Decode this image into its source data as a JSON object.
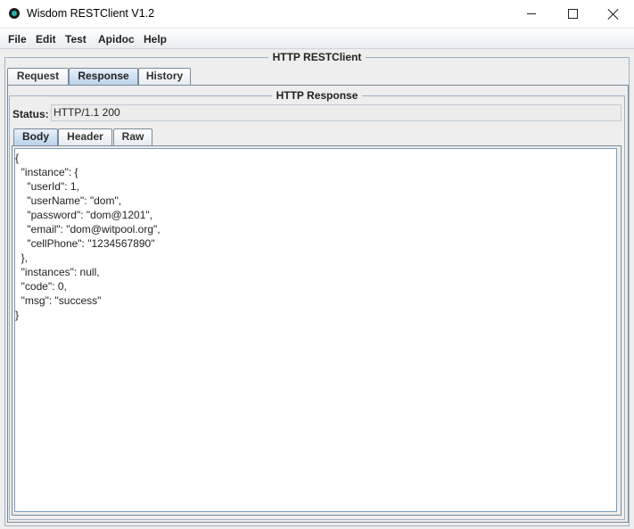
{
  "window": {
    "title": "Wisdom RESTClient V1.2",
    "icon": "app-logo-icon",
    "controls": [
      "minimize-icon",
      "maximize-icon",
      "close-icon"
    ]
  },
  "menu": [
    "File",
    "Edit",
    "Test",
    "Apidoc",
    "Help"
  ],
  "main_panel_title": "HTTP RESTClient",
  "main_tabs": [
    {
      "label": "Request",
      "selected": false
    },
    {
      "label": "Response",
      "selected": true
    },
    {
      "label": "History",
      "selected": false
    }
  ],
  "response_panel": {
    "title": "HTTP Response",
    "status_label": "Status:",
    "status_value": "HTTP/1.1 200",
    "body_tabs": [
      {
        "label": "Body",
        "selected": true
      },
      {
        "label": "Header",
        "selected": false
      },
      {
        "label": "Raw",
        "selected": false
      }
    ],
    "body_content": "{\n  \"instance\": {\n    \"userId\": 1,\n    \"userName\": \"dom\",\n    \"password\": \"dom@1201\",\n    \"email\": \"dom@witpool.org\",\n    \"cellPhone\": \"1234567890\"\n  },\n  \"instances\": null,\n  \"code\": 0,\n  \"msg\": \"success\"\n}"
  },
  "colors": {
    "window_bg": "#eeeeee",
    "tab_selected": "#bcd2ea",
    "border": "#9fb1c5",
    "app_icon_accent": "#27b2b2"
  }
}
